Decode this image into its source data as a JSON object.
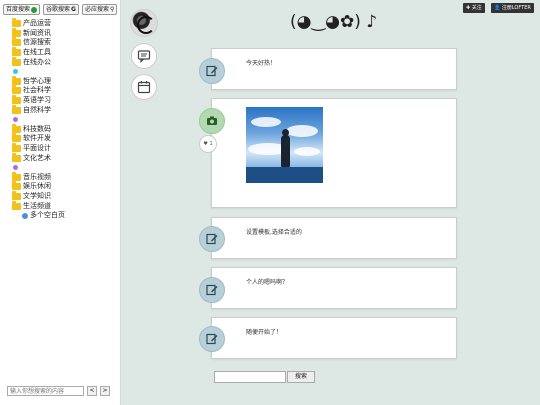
{
  "sidebar": {
    "search_buttons": [
      "百度搜索",
      "谷歌搜索",
      "必应搜索"
    ],
    "items": [
      {
        "label": "产品运营",
        "kind": "folder"
      },
      {
        "label": "新闻资讯",
        "kind": "folder"
      },
      {
        "label": "信源搜索",
        "kind": "folder"
      },
      {
        "label": "在线工具",
        "kind": "folder"
      },
      {
        "label": "在线办公",
        "kind": "folder"
      },
      {
        "label": "",
        "kind": "dot",
        "color": "#3cc6e0"
      },
      {
        "label": "哲学心理",
        "kind": "folder"
      },
      {
        "label": "社会科学",
        "kind": "folder"
      },
      {
        "label": "英语学习",
        "kind": "folder"
      },
      {
        "label": "自然科学",
        "kind": "folder"
      },
      {
        "label": "",
        "kind": "dot",
        "color": "#b070d8"
      },
      {
        "label": "科技数码",
        "kind": "folder"
      },
      {
        "label": "软件开发",
        "kind": "folder"
      },
      {
        "label": "平面设计",
        "kind": "folder"
      },
      {
        "label": "文化艺术",
        "kind": "folder"
      },
      {
        "label": "",
        "kind": "dot",
        "color": "#b070d8"
      },
      {
        "label": "音乐视频",
        "kind": "folder"
      },
      {
        "label": "娱乐休闲",
        "kind": "folder"
      },
      {
        "label": "文学知识",
        "kind": "folder"
      },
      {
        "label": "生活频道",
        "kind": "folder"
      },
      {
        "label": "多个空白页",
        "kind": "globe"
      }
    ],
    "bottom_search_placeholder": "输入你想搜索的内容",
    "prev_label": "<",
    "next_label": ">"
  },
  "header": {
    "title": "(◕‿◕✿) ♪",
    "follow_label": "关注",
    "register_label": "注册LOFTER"
  },
  "posts": [
    {
      "type": "text",
      "text": "今天好热！"
    },
    {
      "type": "photo",
      "likes": "1"
    },
    {
      "type": "text",
      "text": "设置模板,选择合适的"
    },
    {
      "type": "text",
      "text": "个人的嗯吗啊？"
    },
    {
      "type": "text",
      "text": "随便开始了！"
    }
  ],
  "main_search": {
    "button_label": "搜索"
  },
  "colors": {
    "background": "#dde8e5",
    "icon_blue": "#b7cfd8",
    "icon_green": "#b2dab0",
    "folder": "#f2c21b"
  }
}
